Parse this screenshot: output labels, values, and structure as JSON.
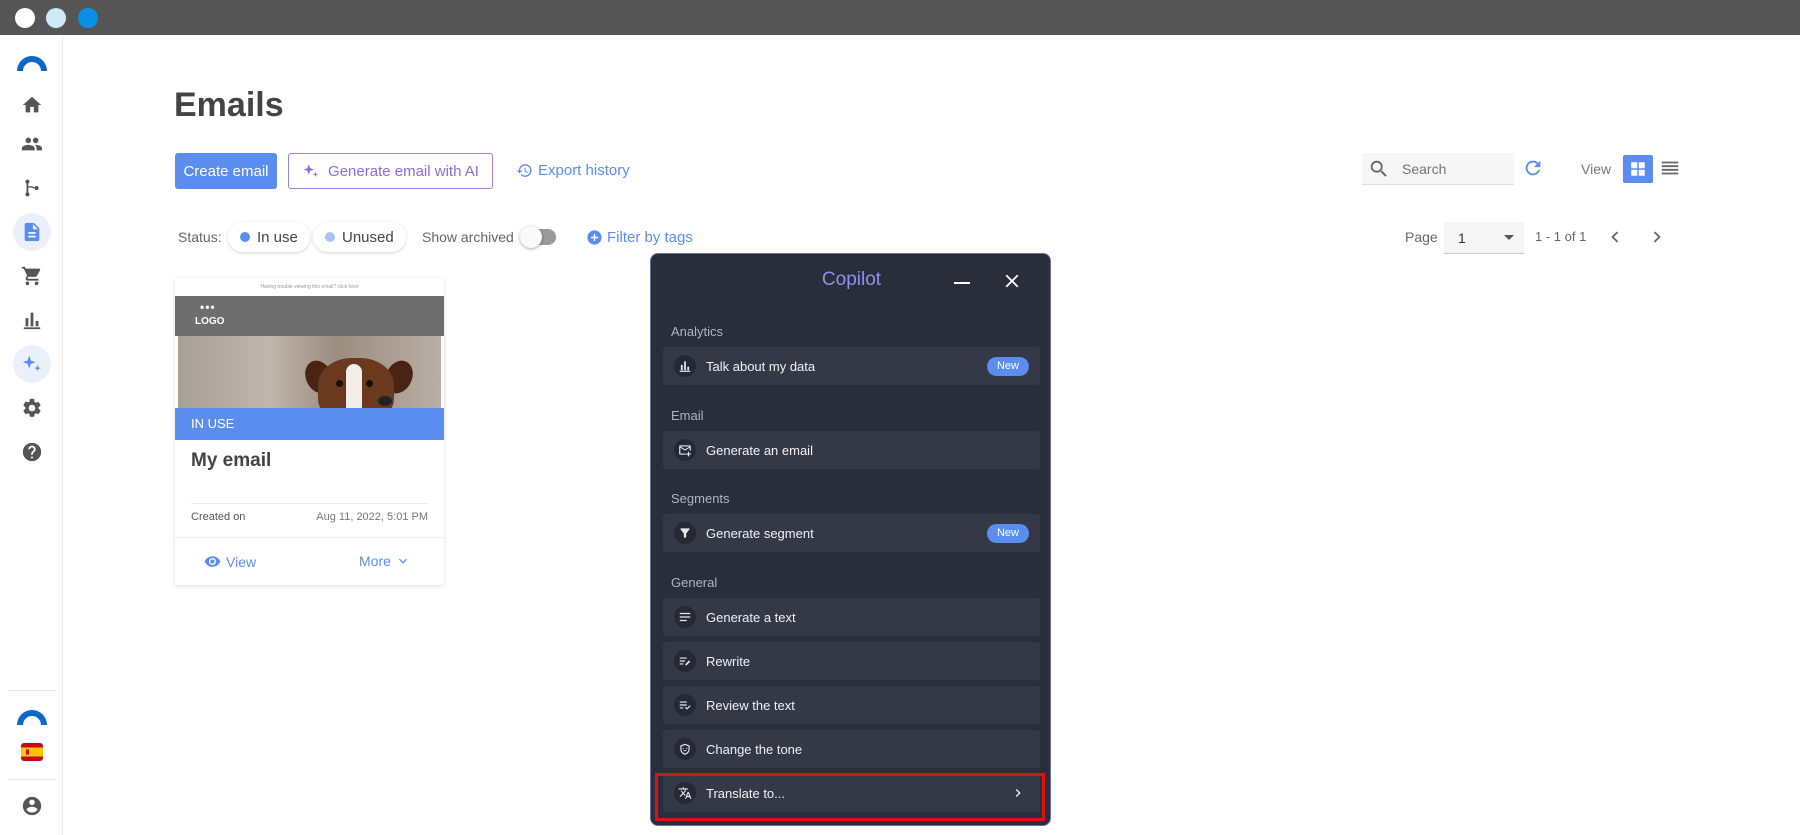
{
  "window": {
    "dots": [
      "#ffffff",
      "#cfe8fa",
      "#0a8fe8"
    ]
  },
  "sidebar": {
    "logo": "brand-logo",
    "items": [
      {
        "name": "home",
        "icon": "home-icon"
      },
      {
        "name": "contacts",
        "icon": "people-icon"
      },
      {
        "name": "automation",
        "icon": "branch-icon"
      },
      {
        "name": "content",
        "icon": "document-icon",
        "active": true
      },
      {
        "name": "ecommerce",
        "icon": "cart-icon"
      },
      {
        "name": "reports",
        "icon": "bar-chart-icon"
      },
      {
        "name": "ai",
        "icon": "sparkle-icon",
        "active": true
      },
      {
        "name": "settings",
        "icon": "gear-icon"
      },
      {
        "name": "help",
        "icon": "help-icon"
      }
    ],
    "bottom": [
      {
        "name": "brand",
        "icon": "brand-logo"
      },
      {
        "name": "language",
        "icon": "spain-flag-icon"
      },
      {
        "name": "account",
        "icon": "account-icon"
      }
    ]
  },
  "page": {
    "title": "Emails"
  },
  "toolbar": {
    "create_label": "Create email",
    "generate_ai_label": "Generate email with AI",
    "export_history_label": "Export history",
    "search_placeholder": "Search",
    "view_label": "View"
  },
  "filters": {
    "status_label": "Status:",
    "in_use_label": "In use",
    "in_use_color": "#5b8def",
    "unused_label": "Unused",
    "unused_color": "#a9c3f5",
    "show_archived_label": "Show archived",
    "show_archived_on": false,
    "filter_tags_label": "Filter by tags"
  },
  "pagination": {
    "page_label": "Page",
    "page_value": "1",
    "range_text": "1 - 1 of 1"
  },
  "card": {
    "thumb_topline": "Having trouble viewing this email? click here",
    "thumb_logo": "LOGO",
    "status_bar": "IN USE",
    "title": "My email",
    "created_label": "Created on",
    "created_date": "Aug 11, 2022, 5:01 PM",
    "view_label": "View",
    "more_label": "More"
  },
  "copilot": {
    "title": "Copilot",
    "sections": [
      {
        "label": "Analytics"
      },
      {
        "label": "Email"
      },
      {
        "label": "Segments"
      },
      {
        "label": "General"
      }
    ],
    "items": [
      {
        "label": "Talk about my data",
        "icon": "bar-chart-icon",
        "badge": "New"
      },
      {
        "label": "Generate an email",
        "icon": "mail-add-icon"
      },
      {
        "label": "Generate segment",
        "icon": "filter-icon",
        "badge": "New"
      },
      {
        "label": "Generate a text",
        "icon": "text-lines-icon"
      },
      {
        "label": "Rewrite",
        "icon": "rewrite-icon"
      },
      {
        "label": "Review the text",
        "icon": "review-check-icon"
      },
      {
        "label": "Change the tone",
        "icon": "tone-mask-icon"
      },
      {
        "label": "Translate to...",
        "icon": "translate-icon",
        "submenu": true,
        "highlighted": true
      }
    ],
    "highlight_color": "#e01010"
  }
}
